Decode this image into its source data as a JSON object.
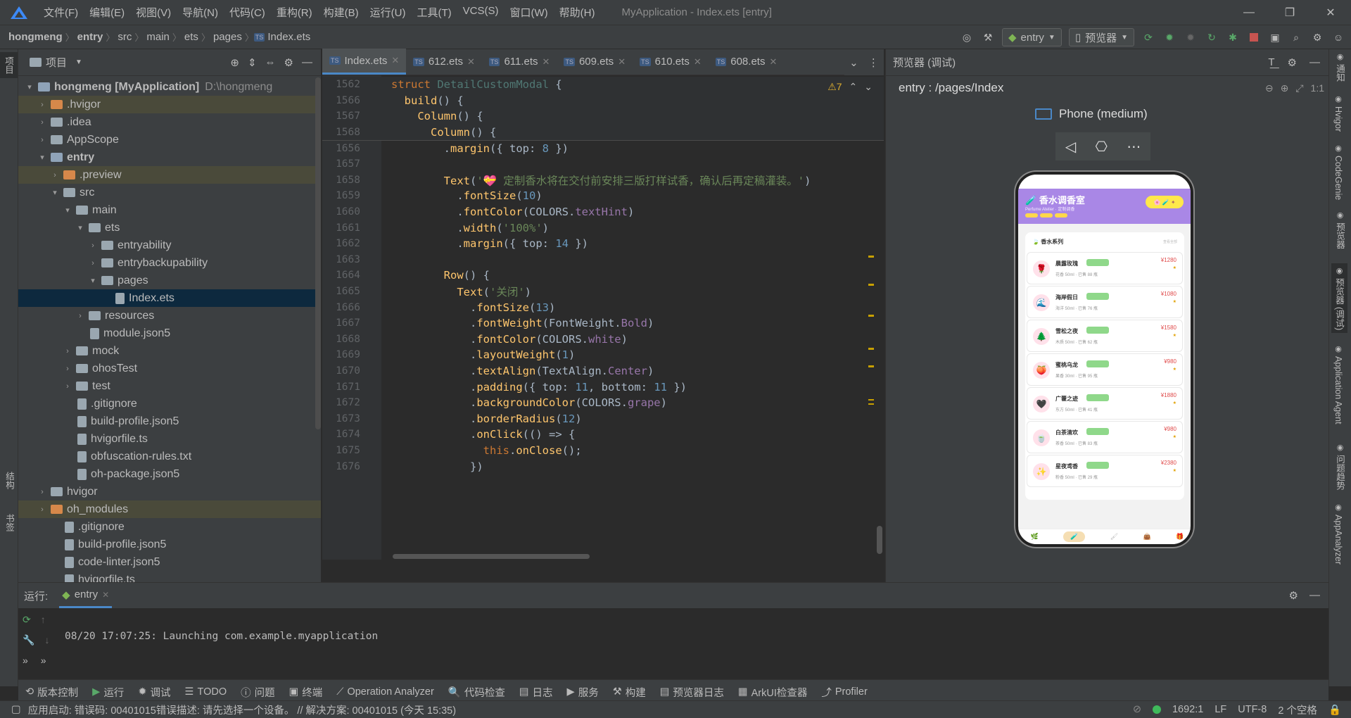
{
  "menubar": {
    "items": [
      "文件(F)",
      "编辑(E)",
      "视图(V)",
      "导航(N)",
      "代码(C)",
      "重构(R)",
      "构建(B)",
      "运行(U)",
      "工具(T)",
      "VCS(S)",
      "窗口(W)",
      "帮助(H)"
    ],
    "window_title": "MyApplication - Index.ets [entry]"
  },
  "breadcrumb": [
    "hongmeng",
    "entry",
    "src",
    "main",
    "ets",
    "pages",
    "Index.ets"
  ],
  "toolbar": {
    "run_config": "entry",
    "previewer": "预览器"
  },
  "project_panel": {
    "title": "项目",
    "tree": [
      {
        "depth": 0,
        "arrow": "▾",
        "type": "folder-blue",
        "label": "hongmeng [MyApplication]",
        "extra": "D:\\hongmeng",
        "bold": true
      },
      {
        "depth": 1,
        "arrow": "›",
        "type": "folder-orange",
        "label": ".hvigor",
        "mod": true
      },
      {
        "depth": 1,
        "arrow": "›",
        "type": "folder-gray",
        "label": ".idea"
      },
      {
        "depth": 1,
        "arrow": "›",
        "type": "folder-gray",
        "label": "AppScope"
      },
      {
        "depth": 1,
        "arrow": "▾",
        "type": "folder-blue",
        "label": "entry",
        "bold": true
      },
      {
        "depth": 2,
        "arrow": "›",
        "type": "folder-orange",
        "label": ".preview",
        "mod": true
      },
      {
        "depth": 2,
        "arrow": "▾",
        "type": "folder-gray",
        "label": "src"
      },
      {
        "depth": 3,
        "arrow": "▾",
        "type": "folder-gray",
        "label": "main"
      },
      {
        "depth": 4,
        "arrow": "▾",
        "type": "folder-gray",
        "label": "ets"
      },
      {
        "depth": 5,
        "arrow": "›",
        "type": "folder-gray",
        "label": "entryability"
      },
      {
        "depth": 5,
        "arrow": "›",
        "type": "folder-gray",
        "label": "entrybackupability"
      },
      {
        "depth": 5,
        "arrow": "▾",
        "type": "folder-gray",
        "label": "pages"
      },
      {
        "depth": 6,
        "arrow": "",
        "type": "file",
        "label": "Index.ets",
        "sel": true
      },
      {
        "depth": 4,
        "arrow": "›",
        "type": "folder-gray",
        "label": "resources"
      },
      {
        "depth": 4,
        "arrow": "",
        "type": "file",
        "label": "module.json5"
      },
      {
        "depth": 3,
        "arrow": "›",
        "type": "folder-gray",
        "label": "mock"
      },
      {
        "depth": 3,
        "arrow": "›",
        "type": "folder-gray",
        "label": "ohosTest"
      },
      {
        "depth": 3,
        "arrow": "›",
        "type": "folder-gray",
        "label": "test"
      },
      {
        "depth": 3,
        "arrow": "",
        "type": "file",
        "label": ".gitignore"
      },
      {
        "depth": 3,
        "arrow": "",
        "type": "file",
        "label": "build-profile.json5"
      },
      {
        "depth": 3,
        "arrow": "",
        "type": "file",
        "label": "hvigorfile.ts"
      },
      {
        "depth": 3,
        "arrow": "",
        "type": "file",
        "label": "obfuscation-rules.txt"
      },
      {
        "depth": 3,
        "arrow": "",
        "type": "file",
        "label": "oh-package.json5"
      },
      {
        "depth": 1,
        "arrow": "›",
        "type": "folder-gray",
        "label": "hvigor"
      },
      {
        "depth": 1,
        "arrow": "›",
        "type": "folder-orange",
        "label": "oh_modules",
        "mod": true
      },
      {
        "depth": 2,
        "arrow": "",
        "type": "file",
        "label": ".gitignore"
      },
      {
        "depth": 2,
        "arrow": "",
        "type": "file",
        "label": "build-profile.json5"
      },
      {
        "depth": 2,
        "arrow": "",
        "type": "file",
        "label": "code-linter.json5"
      },
      {
        "depth": 2,
        "arrow": "",
        "type": "file",
        "label": "hvigorfile.ts"
      }
    ]
  },
  "editor_tabs": [
    "Index.ets",
    "612.ets",
    "611.ets",
    "609.ets",
    "610.ets",
    "608.ets"
  ],
  "warnings_count": "⚠7",
  "code_lines": [
    {
      "n": "1562",
      "html": "<span class='kw'>struct</span> <span class='cls'>DetailCustomModal</span> {",
      "sticky": true
    },
    {
      "n": "1566",
      "html": "  <span class='fn'>build</span>() {",
      "sticky": true
    },
    {
      "n": "1567",
      "html": "    <span class='fn'>Column</span>() {",
      "sticky": true
    },
    {
      "n": "1568",
      "html": "      <span class='fn'>Column</span>() {",
      "sticky": true
    },
    {
      "n": "1656",
      "html": "        .<span class='fn'>margin</span>({ top: <span class='nm'>8</span> })"
    },
    {
      "n": "1657",
      "html": ""
    },
    {
      "n": "1658",
      "html": "        <span class='fn'>Text</span>(<span class='st'>'💝 定制香水将在交付前安排三版打样试香，确认后再定稿灌装。'</span>)"
    },
    {
      "n": "1659",
      "html": "          .<span class='fn'>fontSize</span>(<span class='nm'>10</span>)"
    },
    {
      "n": "1660",
      "html": "          .<span class='fn'>fontColor</span>(COLORS.<span class='pr'>textHint</span>)"
    },
    {
      "n": "1661",
      "html": "          .<span class='fn'>width</span>(<span class='st'>'100%'</span>)"
    },
    {
      "n": "1662",
      "html": "          .<span class='fn'>margin</span>({ top: <span class='nm'>14</span> })"
    },
    {
      "n": "1663",
      "html": ""
    },
    {
      "n": "1664",
      "html": "        <span class='fn'>Row</span>() {"
    },
    {
      "n": "1665",
      "html": "          <span class='fn'>Text</span>(<span class='st'>'关闭'</span>)"
    },
    {
      "n": "1666",
      "html": "            .<span class='fn'>fontSize</span>(<span class='nm'>13</span>)"
    },
    {
      "n": "1667",
      "html": "            .<span class='fn'>fontWeight</span>(FontWeight.<span class='pr'>Bold</span>)"
    },
    {
      "n": "1668",
      "html": "            .<span class='fn'>fontColor</span>(COLORS.<span class='pr'>white</span>)"
    },
    {
      "n": "1669",
      "html": "            .<span class='fn'>layoutWeight</span>(<span class='nm'>1</span>)"
    },
    {
      "n": "1670",
      "html": "            .<span class='fn'>textAlign</span>(TextAlign.<span class='pr'>Center</span>)"
    },
    {
      "n": "1671",
      "html": "            .<span class='fn'>padding</span>({ top: <span class='nm'>11</span>, bottom: <span class='nm'>11</span> })"
    },
    {
      "n": "1672",
      "html": "            .<span class='fn'>backgroundColor</span>(COLORS.<span class='pr'>grape</span>)"
    },
    {
      "n": "1673",
      "html": "            .<span class='fn'>borderRadius</span>(<span class='nm'>12</span>)"
    },
    {
      "n": "1674",
      "html": "            .<span class='fn'>onClick</span>(() => {"
    },
    {
      "n": "1675",
      "html": "              <span class='kw'>this</span>.<span class='fn'>onClose</span>();"
    },
    {
      "n": "1676",
      "html": "            })"
    }
  ],
  "preview": {
    "header": "预览器 (调试)",
    "path": "entry : /pages/Index",
    "device": "Phone (medium)",
    "app": {
      "title": "香水调香室",
      "subtitle": "Perfume Atelier · 定制调香",
      "section": "香水系列",
      "section_more": "查看全部",
      "items": [
        {
          "icon": "🌹",
          "name": "晨露玫瑰",
          "price": "¥1280",
          "meta": "花香 50ml · 已售 88 瓶"
        },
        {
          "icon": "🌊",
          "name": "海岸假日",
          "price": "¥1080",
          "meta": "海洋 50ml · 已售 76 瓶"
        },
        {
          "icon": "🌲",
          "name": "雪松之夜",
          "price": "¥1580",
          "meta": "木质 50ml · 已售 62 瓶"
        },
        {
          "icon": "🍑",
          "name": "蜜桃乌龙",
          "price": "¥980",
          "meta": "果香 30ml · 已售 95 瓶"
        },
        {
          "icon": "🖤",
          "name": "广藿之迹",
          "price": "¥1880",
          "meta": "东方 50ml · 已售 41 瓶"
        },
        {
          "icon": "🍵",
          "name": "白茶清欢",
          "price": "¥980",
          "meta": "茶香 50ml · 已售 83 瓶"
        },
        {
          "icon": "✨",
          "name": "星夜鸢香",
          "price": "¥2380",
          "meta": "粉香 50ml · 已售 29 瓶"
        }
      ]
    }
  },
  "run_panel": {
    "label": "运行:",
    "tab": "entry",
    "log": "08/20 17:07:25: Launching com.example.myapplication"
  },
  "tool_windows": [
    "版本控制",
    "运行",
    "调试",
    "TODO",
    "问题",
    "终端",
    "Operation Analyzer",
    "代码检查",
    "日志",
    "服务",
    "构建",
    "预览器日志",
    "ArkUI检查器",
    "Profiler"
  ],
  "status": {
    "message": "应用启动: 错误码: 00401015错误描述: 请先选择一个设备。 // 解决方案: 00401015 (今天 15:35)",
    "position": "1692:1",
    "line_sep": "LF",
    "encoding": "UTF-8",
    "indent": "2 个空格"
  },
  "right_strip": [
    "通知",
    "Hvigor",
    "CodeGenie",
    "预览器",
    "预览器 (调试)",
    "Application Agent",
    "问题趋势",
    "AppAnalyzer"
  ],
  "left_strip": [
    "项目",
    "结构",
    "书签"
  ],
  "colors": {
    "accent": "#4a88c7",
    "phone_header": "#a987e6",
    "selection": "#0d293e"
  }
}
